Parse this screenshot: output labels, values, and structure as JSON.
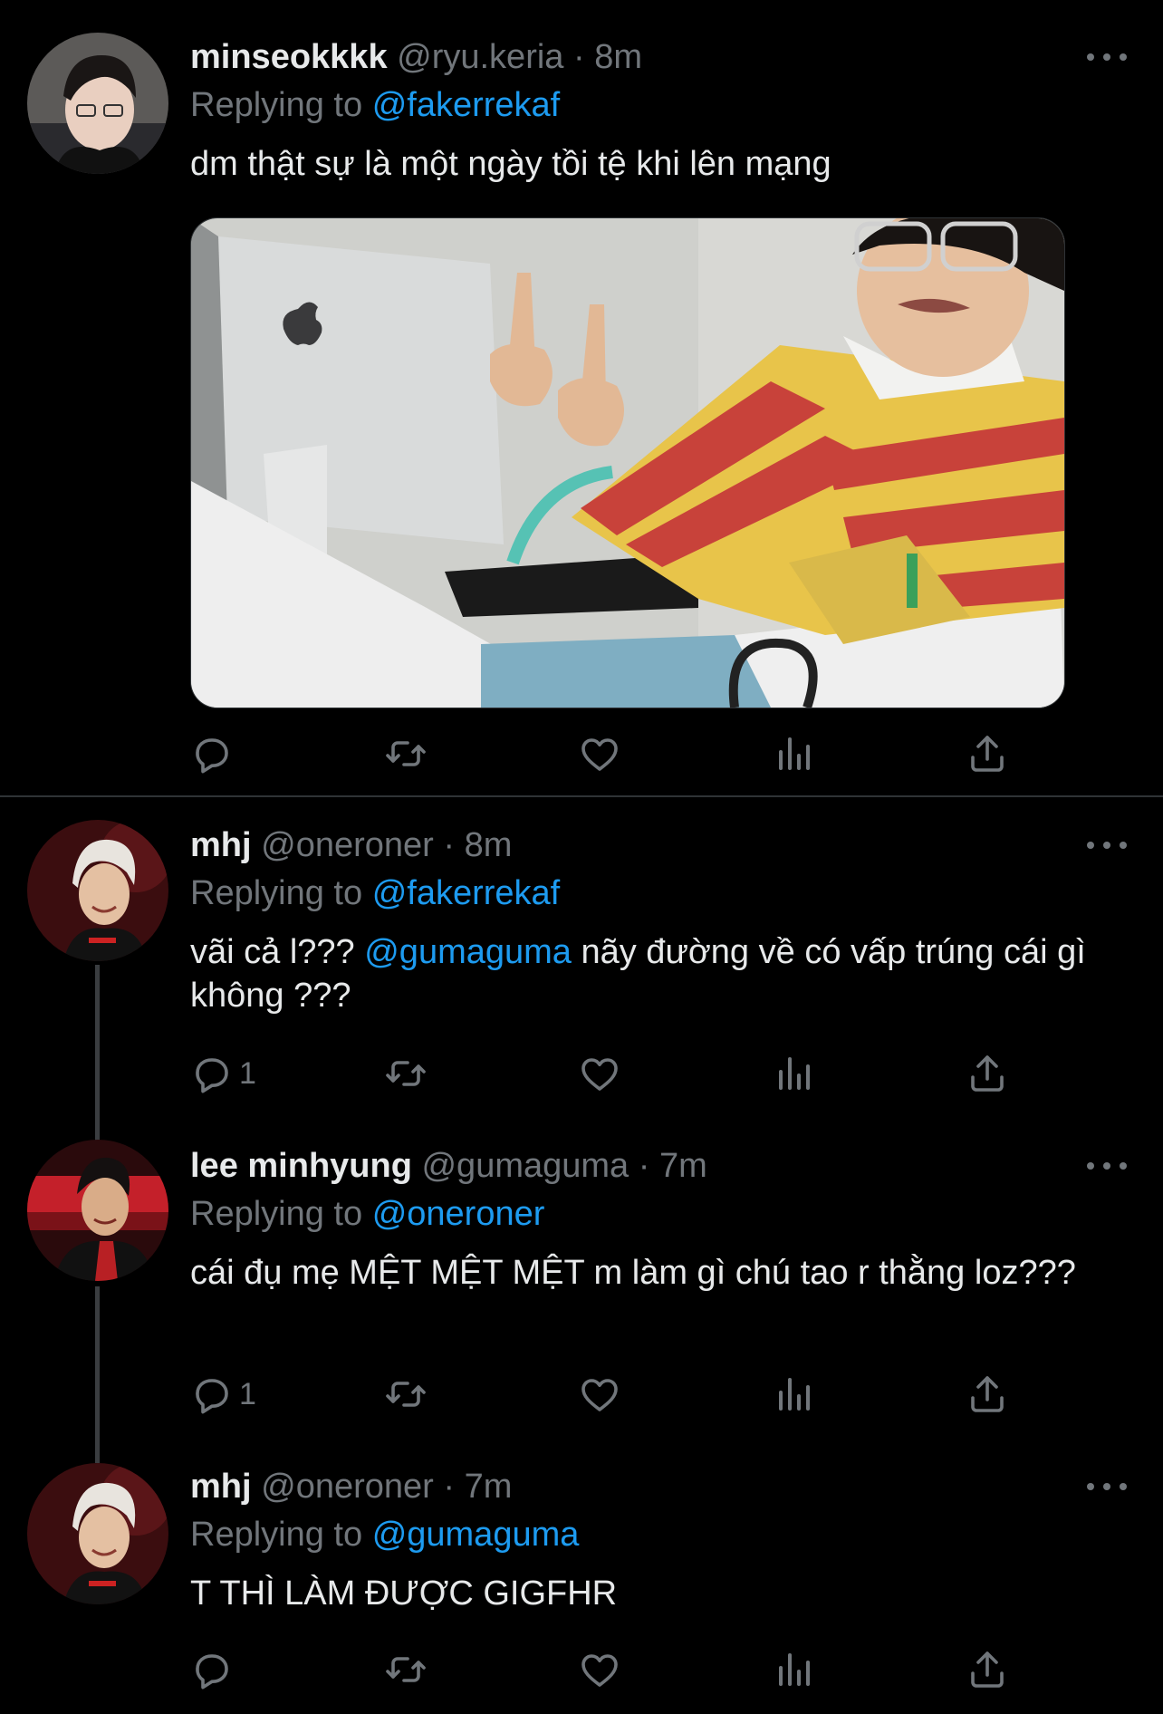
{
  "tweets": [
    {
      "name": "minseokkkk",
      "handle": "@ryu.keria",
      "time": "· 8m",
      "replying_prefix": "Replying to",
      "replying_to": "@fakerrekaf",
      "text": "dm thật sự là một ngày tồi tệ khi lên mạng",
      "reply_count": ""
    },
    {
      "name": "mhj",
      "handle": "@oneroner",
      "time": "· 8m",
      "replying_prefix": "Replying to",
      "replying_to": "@fakerrekaf",
      "text_before": "vãi cả l??? ",
      "text_mention": "@gumaguma",
      "text_after": " nãy đường về có vấp trúng cái gì không ???",
      "reply_count": "1"
    },
    {
      "name": "lee minhyung",
      "handle": "@gumaguma",
      "time": "· 7m",
      "replying_prefix": "Replying to",
      "replying_to": "@oneroner",
      "text": "cái đụ mẹ MỆT MỆT MỆT m làm gì chú tao r thằng loz???",
      "reply_count": "1"
    },
    {
      "name": "mhj",
      "handle": "@oneroner",
      "time": "· 7m",
      "replying_prefix": "Replying to",
      "replying_to": "@gumaguma",
      "text": "T THÌ LÀM ĐƯỢC GIGFHR",
      "reply_count": ""
    }
  ],
  "icons": [
    "reply-icon",
    "retweet-icon",
    "like-icon",
    "views-icon",
    "share-icon",
    "more-icon"
  ],
  "colors": {
    "background": "#000000",
    "text": "#e7e9ea",
    "muted": "#71767b",
    "link": "#1d9bf0",
    "divider": "#2f3336"
  }
}
